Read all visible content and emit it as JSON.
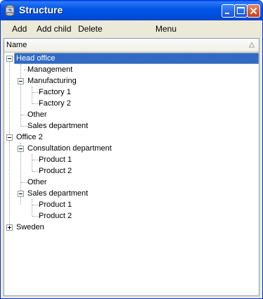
{
  "window": {
    "title": "Structure"
  },
  "menu": {
    "add": "Add",
    "add_child": "Add child",
    "delete": "Delete",
    "menu": "Menu"
  },
  "grid": {
    "column_name": "Name"
  },
  "tree": {
    "head_office": "Head office",
    "management": "Management",
    "manufacturing": "Manufacturing",
    "factory1": "Factory 1",
    "factory2": "Factory 2",
    "ho_other": "Other",
    "ho_sales": "Sales department",
    "office2": "Office 2",
    "consultation": "Consultation department",
    "c_product1": "Product 1",
    "c_product2": "Product 2",
    "o2_other": "Other",
    "o2_sales": "Sales department",
    "s_product1": "Product 1",
    "s_product2": "Product 2",
    "sweden": "Sweden"
  },
  "colors": {
    "selection": "#316ac5",
    "titlebar": "#0054e3"
  }
}
